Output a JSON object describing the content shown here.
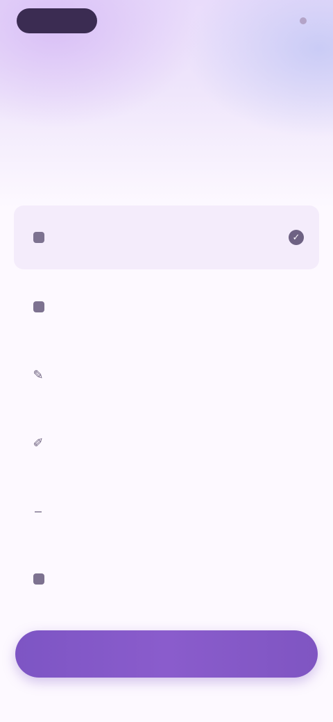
{
  "header": {
    "right_text": "",
    "eyebrow": ""
  },
  "headline": {
    "line1": "",
    "line2": ""
  },
  "subtitle": "",
  "options": [
    {
      "label": "",
      "icon": "square-icon",
      "selected": true
    },
    {
      "label": "",
      "icon": "square-icon",
      "selected": false
    },
    {
      "label": "",
      "icon": "pencil-icon",
      "selected": false
    },
    {
      "label": "",
      "icon": "chat-icon",
      "selected": false
    },
    {
      "label": "",
      "icon": "dash-icon",
      "selected": false
    },
    {
      "label": "",
      "icon": "square-icon",
      "selected": false
    }
  ],
  "cta": {
    "label": ""
  },
  "colors": {
    "accent": "#7d55c4",
    "background": "#fdf9ff",
    "headline": "#3e3552",
    "selected_row": "#f4ecfb",
    "top_pill": "#3b2c52"
  }
}
